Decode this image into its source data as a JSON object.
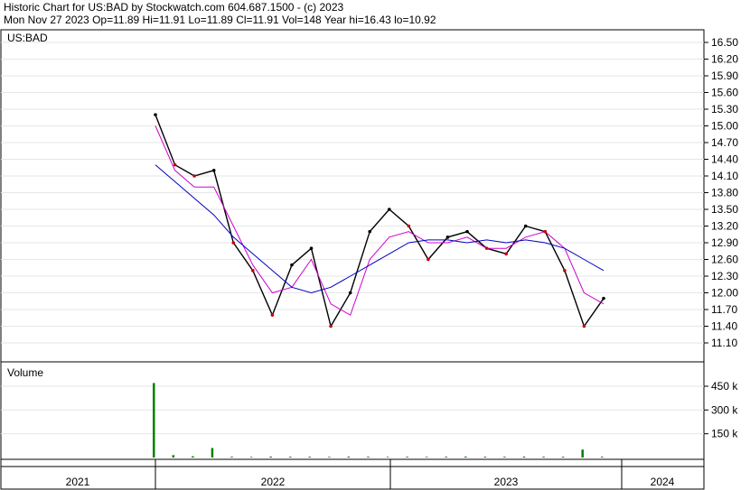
{
  "header": {
    "line1": "Historic Chart for US:BAD by Stockwatch.com 604.687.1500 - (c) 2023",
    "line2": "Mon Nov 27 2023   Op=11.89  Hi=11.91  Lo=11.89  Cl=11.91  Vol=148  Year hi=16.43  lo=10.92"
  },
  "colors": {
    "price": "#000000",
    "ma_short": "#d000d0",
    "ma_long": "#0000c0",
    "volume": "#008000",
    "volume_down": "#cc0000"
  },
  "chart_data": [
    {
      "type": "line",
      "title": "US:BAD",
      "ylim": [
        10.9,
        16.6
      ],
      "y_ticks": [
        "16.50",
        "16.20",
        "15.90",
        "15.60",
        "15.30",
        "15.00",
        "14.70",
        "14.40",
        "14.10",
        "13.80",
        "13.50",
        "13.20",
        "12.90",
        "12.60",
        "12.30",
        "12.00",
        "11.70",
        "11.40",
        "11.10"
      ],
      "x_ticks": [
        "2021",
        "2022",
        "2023",
        "2024"
      ],
      "x": [
        "2021-12",
        "2022-01",
        "2022-02",
        "2022-03",
        "2022-04",
        "2022-05",
        "2022-06",
        "2022-07",
        "2022-08",
        "2022-09",
        "2022-10",
        "2022-11",
        "2022-12",
        "2023-01",
        "2023-02",
        "2023-03",
        "2023-04",
        "2023-05",
        "2023-06",
        "2023-07",
        "2023-08",
        "2023-09",
        "2023-10",
        "2023-11"
      ],
      "series": [
        {
          "values": [
            15.2,
            14.3,
            14.1,
            14.2,
            12.9,
            12.4,
            11.6,
            12.5,
            12.8,
            11.4,
            12.0,
            13.1,
            13.5,
            13.2,
            12.6,
            13.0,
            13.1,
            12.8,
            12.7,
            13.2,
            13.1,
            12.4,
            11.4,
            11.9
          ]
        },
        {
          "values": [
            15.0,
            14.2,
            13.9,
            13.9,
            13.2,
            12.5,
            12.0,
            12.1,
            12.6,
            11.8,
            11.6,
            12.6,
            13.0,
            13.1,
            12.9,
            12.9,
            13.0,
            12.8,
            12.8,
            13.0,
            13.1,
            12.8,
            12.0,
            11.8
          ]
        },
        {
          "values": [
            14.3,
            14.0,
            13.7,
            13.4,
            13.0,
            12.7,
            12.4,
            12.1,
            12.0,
            12.1,
            12.3,
            12.5,
            12.7,
            12.9,
            12.95,
            12.95,
            12.9,
            12.95,
            12.9,
            12.95,
            12.9,
            12.8,
            12.6,
            12.4
          ]
        }
      ]
    },
    {
      "type": "bar",
      "title": "Volume",
      "ylim": [
        0,
        500000
      ],
      "y_ticks": [
        "450 k",
        "300 k",
        "150 k"
      ],
      "x": [
        "2021-12",
        "2022-01",
        "2022-02",
        "2022-03",
        "2022-04",
        "2022-05",
        "2022-06",
        "2022-07",
        "2022-08",
        "2022-09",
        "2022-10",
        "2022-11",
        "2022-12",
        "2023-01",
        "2023-02",
        "2023-03",
        "2023-04",
        "2023-05",
        "2023-06",
        "2023-07",
        "2023-08",
        "2023-09",
        "2023-10",
        "2023-11"
      ],
      "values": [
        470000,
        15000,
        8000,
        60000,
        5000,
        4000,
        6000,
        5000,
        5000,
        4000,
        6000,
        5000,
        4000,
        5000,
        4000,
        5000,
        6000,
        5000,
        5000,
        6000,
        5000,
        5000,
        50000,
        5000
      ]
    }
  ]
}
